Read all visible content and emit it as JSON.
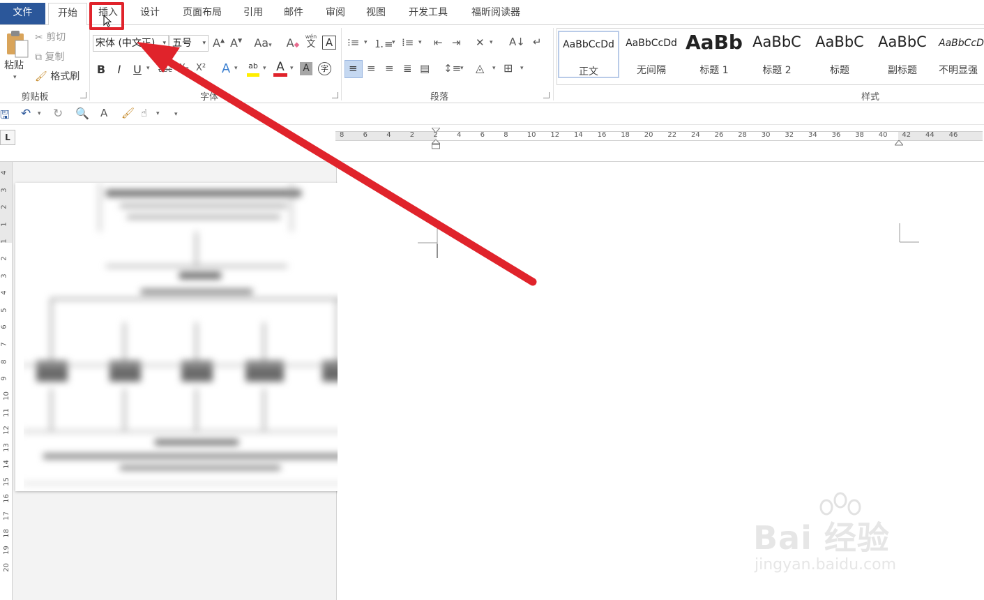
{
  "tabs": {
    "file": "文件",
    "home": "开始",
    "insert": "插入",
    "design": "设计",
    "layout": "页面布局",
    "references": "引用",
    "mailings": "邮件",
    "review": "审阅",
    "view": "视图",
    "developer": "开发工具",
    "foxit": "福昕阅读器"
  },
  "clipboard": {
    "paste": "粘贴",
    "cut": "剪切",
    "copy": "复制",
    "format_painter": "格式刷",
    "group_label": "剪贴板"
  },
  "font": {
    "font_name": "宋体 (中文正)",
    "font_size": "五号",
    "group_label": "字体",
    "change_case": "Aa",
    "phonetic_top": "wén",
    "phonetic_char": "文",
    "bold": "B",
    "italic": "I",
    "underline": "U",
    "strikethrough": "abc",
    "subscript": "X₂",
    "superscript": "X²",
    "text_effect": "A",
    "highlight": "ab",
    "font_color": "A",
    "char_shading": "A",
    "enclose": "字"
  },
  "paragraph": {
    "group_label": "段落"
  },
  "styles": {
    "group_label": "样式",
    "items": [
      {
        "preview": "AaBbCcDd",
        "name": "正文"
      },
      {
        "preview": "AaBbCcDd",
        "name": "无间隔"
      },
      {
        "preview": "AaBb",
        "name": "标题 1"
      },
      {
        "preview": "AaBbC",
        "name": "标题 2"
      },
      {
        "preview": "AaBbC",
        "name": "标题"
      },
      {
        "preview": "AaBbC",
        "name": "副标题"
      },
      {
        "preview": "AaBbCcD",
        "name": "不明显强调"
      }
    ]
  },
  "ruler": {
    "corner": "L",
    "h_labels": [
      "8",
      "6",
      "4",
      "2",
      "2",
      "4",
      "6",
      "8",
      "10",
      "12",
      "14",
      "16",
      "18",
      "20",
      "22",
      "24",
      "26",
      "28",
      "30",
      "32",
      "34",
      "36",
      "38",
      "40",
      "42",
      "44",
      "46"
    ],
    "v_labels": [
      "4",
      "3",
      "2",
      "1",
      "1",
      "2",
      "3",
      "4",
      "5",
      "6",
      "7",
      "8",
      "9",
      "10",
      "11",
      "12",
      "13",
      "14",
      "15",
      "16",
      "17",
      "18",
      "19",
      "20"
    ]
  },
  "watermark": {
    "brand": "Bai 经验",
    "url": "jingyan.baidu.com"
  },
  "colors": {
    "file_tab": "#2b579a",
    "highlight_red": "#e0232b"
  }
}
